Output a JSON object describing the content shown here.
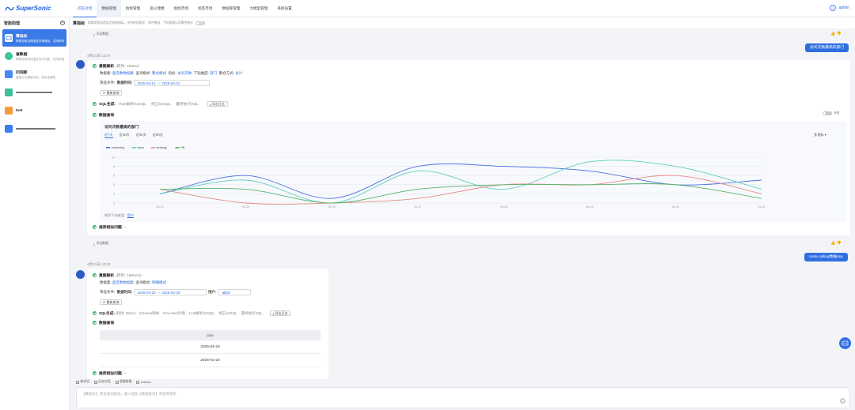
{
  "app": {
    "brand": "SuperSonic",
    "user": "admin"
  },
  "nav": [
    "问答对话",
    "数据管理",
    "指标管理",
    "语义建模",
    "指标市场",
    "标签市场",
    "数据库管理",
    "大模型管理",
    "系统设置"
  ],
  "sidebar": {
    "title": "智能助理",
    "items": [
      {
        "title": "算指标",
        "desc": "帮助您用自然语言查询指标，支持时间限定、条件筛选、下钻维度以及聚合统计",
        "icon_color": "#ffffff",
        "active": true
      },
      {
        "title": "查数据",
        "desc": "帮助您用自然语言进行问数，支持多维查询",
        "icon_color": "#3cc49c"
      },
      {
        "title": "问词醉",
        "desc": "直接与大模型对话，验证连通性",
        "icon_color": "#4b89f0"
      },
      {
        "title": "",
        "desc": "",
        "icon_color": "#3bbf9a"
      },
      {
        "title": "test",
        "desc": "",
        "icon_color": "#f39a3c"
      },
      {
        "title": "",
        "desc": "",
        "icon_color": "#3a7ff0"
      }
    ]
  },
  "header": {
    "title": "算指标",
    "desc": "帮助您用自然语言查询指标，支持时间限定、条件筛选、下钻维度以及聚合统计",
    "toggle_label": "调试模式"
  },
  "conv1": {
    "export_label": "导出数据",
    "timestamp": "4月21日 13:07",
    "user_question": "访问次数最高的部门",
    "intent_title": "意图解析",
    "intent_time": "(耗时: 303ms)",
    "dataset_label": "数据集:",
    "dataset_value": "超音数数据集",
    "query_mode_label": "查询模式:",
    "query_mode_value": "聚合模式",
    "metric_label": "指标:",
    "metric_value": "访问次数",
    "drill_label": "下钻维度:",
    "drill_value": "部门",
    "agg_label": "聚合方式:",
    "agg_value": "总计",
    "filter_label": "筛选条件:",
    "date_label": "数据时间:",
    "date_start": "2025-04-14",
    "date_sep": "~",
    "date_end": "2025-04-21",
    "requery": "重新查询",
    "sql_title": "SQL生成:",
    "sql_steps": [
      "Rule解析S2SQL",
      "修正S2SQL",
      "最终执行SQL"
    ],
    "export_log": "导出日志",
    "data_title": "数据查询",
    "data_toggle": "表格",
    "chart_title": "访问次数最高的部门",
    "chart_tabs": [
      "近7天",
      "近30天",
      "近60天",
      "近90天"
    ],
    "metric_switch": "多指标",
    "drill_hint_label": "推荐下钻维度:",
    "drill_hint_value": "用户",
    "recommend": "推荐相似问题"
  },
  "chart_data": {
    "type": "line",
    "title": "访问次数最高的部门",
    "x": [
      "04-14",
      "04-15",
      "04-16",
      "04-17",
      "04-18",
      "04-19",
      "04-20",
      "04-21"
    ],
    "ylim": [
      0,
      10
    ],
    "yticks": [
      0,
      2,
      4,
      6,
      8,
      10
    ],
    "grid": true,
    "legend": "top-left",
    "series": [
      {
        "name": "marketing",
        "color": "#4a6fe3",
        "values": [
          2,
          6,
          1,
          8,
          8,
          7,
          4,
          5
        ]
      },
      {
        "name": "sales",
        "color": "#5ecfbf",
        "values": [
          2,
          5,
          0,
          7,
          3,
          9,
          8,
          3
        ]
      },
      {
        "name": "strategy",
        "color": "#e88a86",
        "values": [
          3,
          0,
          0,
          1,
          4,
          4,
          6,
          2
        ]
      },
      {
        "name": "HR",
        "color": "#56b36b",
        "values": [
          3,
          3,
          0,
          3,
          4,
          4,
          4,
          1
        ]
      }
    ]
  },
  "conv2": {
    "export_label": "导出数据",
    "timestamp": "4月21日 13:32",
    "user_question": "mata calling数据ssa",
    "intent_title": "意图解析",
    "intent_time": "(耗时: 1886ms)",
    "dataset_label": "数据集:",
    "dataset_value": "超音数数据集",
    "query_mode_label": "查询模式:",
    "query_mode_value": "明细模式",
    "filter_label": "筛选条件:",
    "date_label": "数据时间:",
    "date_start": "2025-04-20",
    "date_sep": "~",
    "date_end": "2025-04-20",
    "user_label": "用户:",
    "user_tag": "alice",
    "requery": "重新查询",
    "sql_title": "SQL生成:",
    "sql_time": "(耗时: 55ms) :",
    "sql_steps": [
      "Schema映射",
      "Few-shot示例",
      "LLM解析S2SQL",
      "修正S2SQL",
      "最终执行SQL"
    ],
    "export_log": "导出日志",
    "data_title": "数据查询",
    "table_header": "date",
    "table_rows": [
      "2025-04-20",
      "2025-04-20"
    ],
    "recommend": "推荐相似问题"
  },
  "toolbar": [
    "新对话",
    "历史对话",
    "智能助理",
    "chinese"
  ],
  "input_placeholder": "【算指标】 帮您查询指标，输入后按【数据查询】将查询更新"
}
